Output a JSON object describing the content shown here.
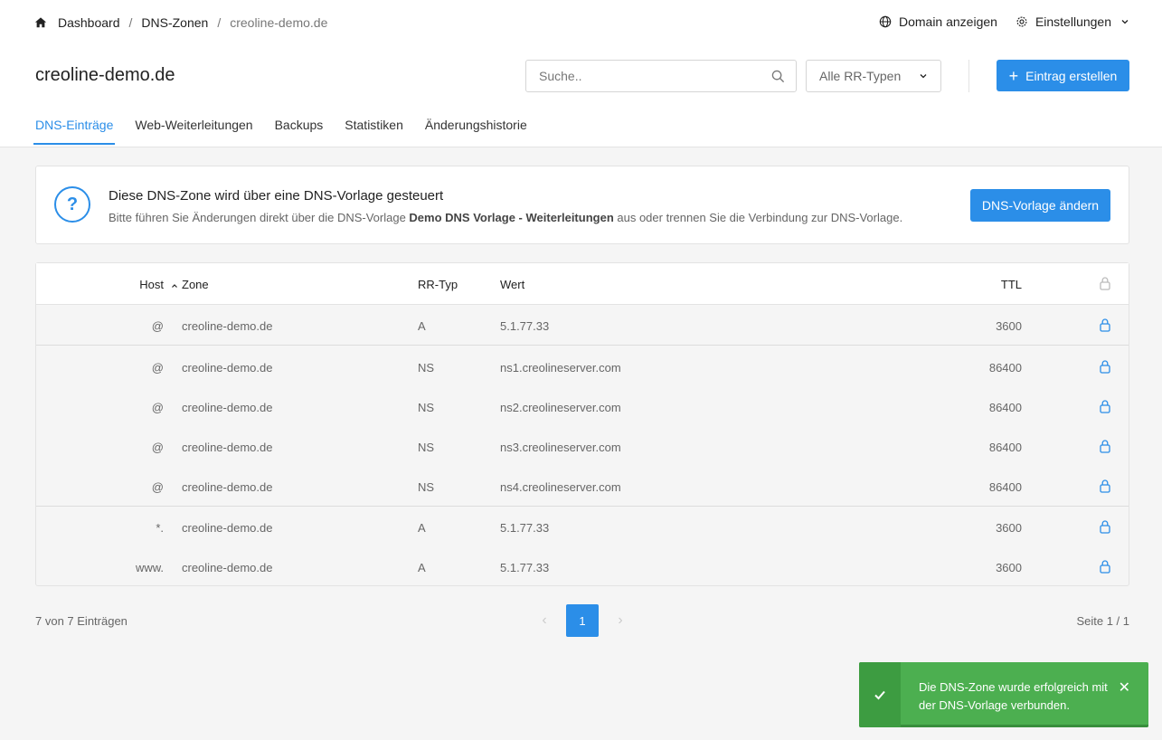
{
  "breadcrumb": {
    "home": "Dashboard",
    "zones": "DNS-Zonen",
    "current": "creoline-demo.de"
  },
  "top_actions": {
    "show_domain": "Domain anzeigen",
    "settings": "Einstellungen"
  },
  "page_title": "creoline-demo.de",
  "search": {
    "placeholder": "Suche..",
    "value": ""
  },
  "filter": {
    "selected": "Alle RR-Typen"
  },
  "create_button": "Eintrag erstellen",
  "tabs": [
    {
      "label": "DNS-Einträge",
      "active": true
    },
    {
      "label": "Web-Weiterleitungen"
    },
    {
      "label": "Backups"
    },
    {
      "label": "Statistiken"
    },
    {
      "label": "Änderungshistorie"
    }
  ],
  "notice": {
    "title": "Diese DNS-Zone wird über eine DNS-Vorlage gesteuert",
    "text_before": "Bitte führen Sie Änderungen direkt über die DNS-Vorlage ",
    "template_name": "Demo DNS Vorlage - Weiterleitungen",
    "text_after": " aus oder trennen Sie die Verbindung zur DNS-Vorlage.",
    "button": "DNS-Vorlage ändern"
  },
  "table": {
    "headers": {
      "host": "Host",
      "zone": "Zone",
      "rr": "RR-Typ",
      "value": "Wert",
      "ttl": "TTL"
    },
    "rows": [
      {
        "host": "@",
        "zone": "creoline-demo.de",
        "rr": "A",
        "value": "5.1.77.33",
        "ttl": "3600"
      },
      {
        "host": "@",
        "zone": "creoline-demo.de",
        "rr": "NS",
        "value": "ns1.creolineserver.com",
        "ttl": "86400"
      },
      {
        "host": "@",
        "zone": "creoline-demo.de",
        "rr": "NS",
        "value": "ns2.creolineserver.com",
        "ttl": "86400"
      },
      {
        "host": "@",
        "zone": "creoline-demo.de",
        "rr": "NS",
        "value": "ns3.creolineserver.com",
        "ttl": "86400"
      },
      {
        "host": "@",
        "zone": "creoline-demo.de",
        "rr": "NS",
        "value": "ns4.creolineserver.com",
        "ttl": "86400"
      },
      {
        "host": "*.",
        "zone": "creoline-demo.de",
        "rr": "A",
        "value": "5.1.77.33",
        "ttl": "3600"
      },
      {
        "host": "www.",
        "zone": "creoline-demo.de",
        "rr": "A",
        "value": "5.1.77.33",
        "ttl": "3600"
      }
    ]
  },
  "footer": {
    "entries": "7 von 7 Einträgen",
    "current_page": "1",
    "page_count": "Seite 1 / 1"
  },
  "toast": {
    "message": "Die DNS-Zone wurde erfolgreich mit der DNS-Vorlage verbunden.",
    "close": "✕"
  },
  "colors": {
    "accent": "#2b8ee8",
    "success": "#4caf50"
  }
}
